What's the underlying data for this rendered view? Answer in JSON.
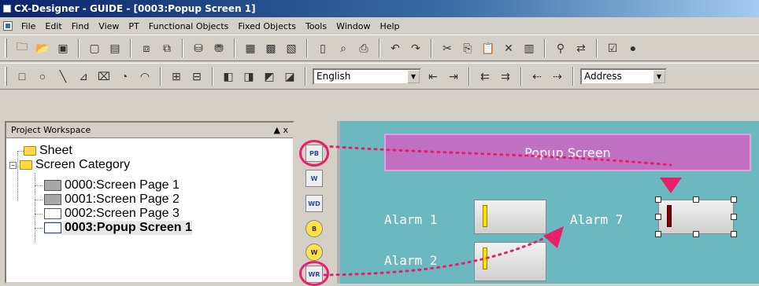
{
  "window": {
    "title": "CX-Designer - GUIDE - [0003:Popup Screen 1]"
  },
  "menu": [
    "File",
    "Edit",
    "Find",
    "View",
    "PT",
    "Functional Objects",
    "Fixed Objects",
    "Tools",
    "Window",
    "Help"
  ],
  "toolbar": {
    "language": "English",
    "address": "Address"
  },
  "workspace": {
    "title": "Project Workspace",
    "pin": "▲ x",
    "tree": {
      "sheet": "Sheet",
      "screen_category": "Screen Category",
      "pages": [
        "0000:Screen Page 1",
        "0001:Screen Page 2",
        "0002:Screen Page 3",
        "0003:Popup Screen 1"
      ]
    }
  },
  "object_toolbar": {
    "items": [
      {
        "name": "PB"
      },
      {
        "name": "W"
      },
      {
        "name": "WD"
      },
      {
        "name": "B"
      },
      {
        "name": "W"
      },
      {
        "name": "WR"
      }
    ]
  },
  "canvas": {
    "popup_label": "Popup Screen",
    "alarms": [
      "Alarm 1",
      "Alarm 2",
      "Alarm 7"
    ]
  },
  "colors": {
    "accent": "#e8206a",
    "canvas": "#6cb8c0",
    "popup": "#c070c0"
  }
}
